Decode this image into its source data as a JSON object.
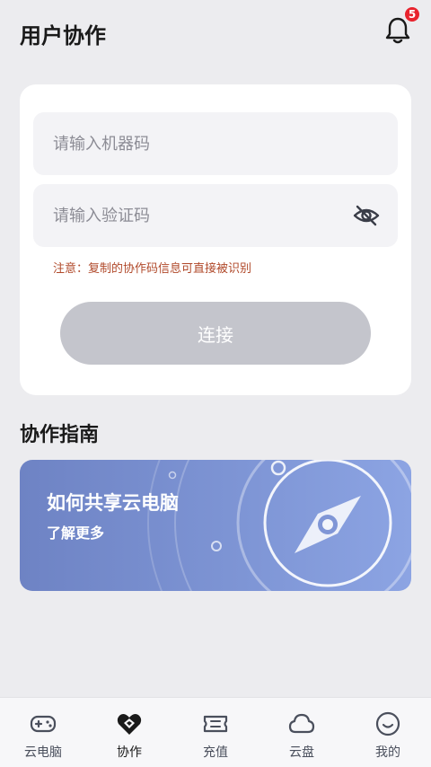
{
  "header": {
    "title": "用户协作",
    "notification_count": "5",
    "notification_icon": "bell-icon"
  },
  "form": {
    "code_placeholder": "请输入机器码",
    "verify_placeholder": "请输入验证码",
    "visibility_icon": "eye-off-icon",
    "note": "注意：复制的协作码信息可直接被识别",
    "connect_label": "连接"
  },
  "guide": {
    "section_title": "协作指南",
    "banner_title": "如何共享云电脑",
    "banner_subtitle": "了解更多",
    "banner_icon": "compass-icon"
  },
  "nav": {
    "items": [
      {
        "label": "云电脑",
        "icon": "gamepad-icon",
        "active": false
      },
      {
        "label": "协作",
        "icon": "collaborate-icon",
        "active": true
      },
      {
        "label": "充值",
        "icon": "ticket-icon",
        "active": false
      },
      {
        "label": "云盘",
        "icon": "cloud-icon",
        "active": false
      },
      {
        "label": "我的",
        "icon": "smile-icon",
        "active": false
      }
    ]
  },
  "colors": {
    "background": "#ececef",
    "badge": "#e8232d",
    "note": "#b0492a",
    "button_disabled": "#c4c5cc",
    "banner_start": "#6e83c4",
    "banner_end": "#8ca4e3"
  }
}
